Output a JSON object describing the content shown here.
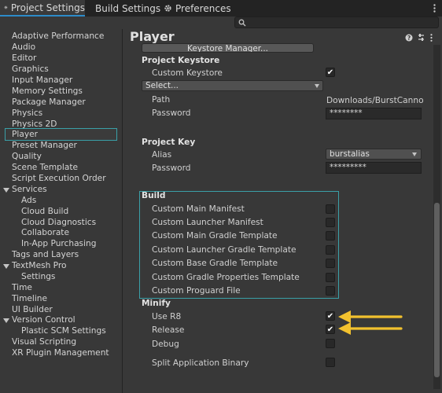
{
  "tabs": [
    {
      "label": "Project Settings",
      "active": true
    },
    {
      "label": "Build Settings"
    },
    {
      "label": "Preferences"
    }
  ],
  "search": {
    "placeholder": ""
  },
  "sidebar": {
    "items": [
      {
        "label": "Adaptive Performance"
      },
      {
        "label": "Audio"
      },
      {
        "label": "Editor"
      },
      {
        "label": "Graphics"
      },
      {
        "label": "Input Manager"
      },
      {
        "label": "Memory Settings"
      },
      {
        "label": "Package Manager"
      },
      {
        "label": "Physics"
      },
      {
        "label": "Physics 2D"
      },
      {
        "label": "Player",
        "selected": true
      },
      {
        "label": "Preset Manager"
      },
      {
        "label": "Quality"
      },
      {
        "label": "Scene Template"
      },
      {
        "label": "Script Execution Order"
      },
      {
        "label": "Services",
        "expanded": true
      },
      {
        "label": "Ads"
      },
      {
        "label": "Cloud Build"
      },
      {
        "label": "Cloud Diagnostics"
      },
      {
        "label": "Collaborate"
      },
      {
        "label": "In-App Purchasing"
      },
      {
        "label": "Tags and Layers"
      },
      {
        "label": "TextMesh Pro",
        "expanded": true
      },
      {
        "label": "Settings"
      },
      {
        "label": "Time"
      },
      {
        "label": "Timeline"
      },
      {
        "label": "UI Builder"
      },
      {
        "label": "Version Control",
        "expanded": true
      },
      {
        "label": "Plastic SCM Settings"
      },
      {
        "label": "Visual Scripting"
      },
      {
        "label": "XR Plugin Management"
      }
    ]
  },
  "main": {
    "title": "Player",
    "keystore_manager_button": "Keystore Manager...",
    "project_keystore": {
      "header": "Project Keystore",
      "custom_keystore_label": "Custom Keystore",
      "custom_keystore_checked": true,
      "select_value": "Select...",
      "path_label": "Path",
      "path_value": "Downloads/BurstCannon",
      "password_label": "Password",
      "password_value": "********"
    },
    "project_key": {
      "header": "Project Key",
      "alias_label": "Alias",
      "alias_value": "burstalias",
      "password_label": "Password",
      "password_value": "*********"
    },
    "build": {
      "header": "Build",
      "items": [
        {
          "label": "Custom Main Manifest",
          "checked": false
        },
        {
          "label": "Custom Launcher Manifest",
          "checked": false
        },
        {
          "label": "Custom Main Gradle Template",
          "checked": false
        },
        {
          "label": "Custom Launcher Gradle Template",
          "checked": false
        },
        {
          "label": "Custom Base Gradle Template",
          "checked": false
        },
        {
          "label": "Custom Gradle Properties Template",
          "checked": false
        },
        {
          "label": "Custom Proguard File",
          "checked": false
        }
      ]
    },
    "minify": {
      "header": "Minify",
      "items": [
        {
          "label": "Use R8",
          "checked": true
        },
        {
          "label": "Release",
          "checked": true
        },
        {
          "label": "Debug",
          "checked": false
        }
      ]
    },
    "split_binary": {
      "label": "Split Application Binary",
      "checked": false
    }
  },
  "colors": {
    "highlight": "#3aa0a8",
    "annotation_arrow": "#f2c12e",
    "tab_accent": "#2d8bc9"
  },
  "icons": [
    "gear-icon",
    "help-icon",
    "preset-icon",
    "kebab-menu-icon",
    "search-icon",
    "checkmark-icon",
    "arrow-annotation"
  ]
}
